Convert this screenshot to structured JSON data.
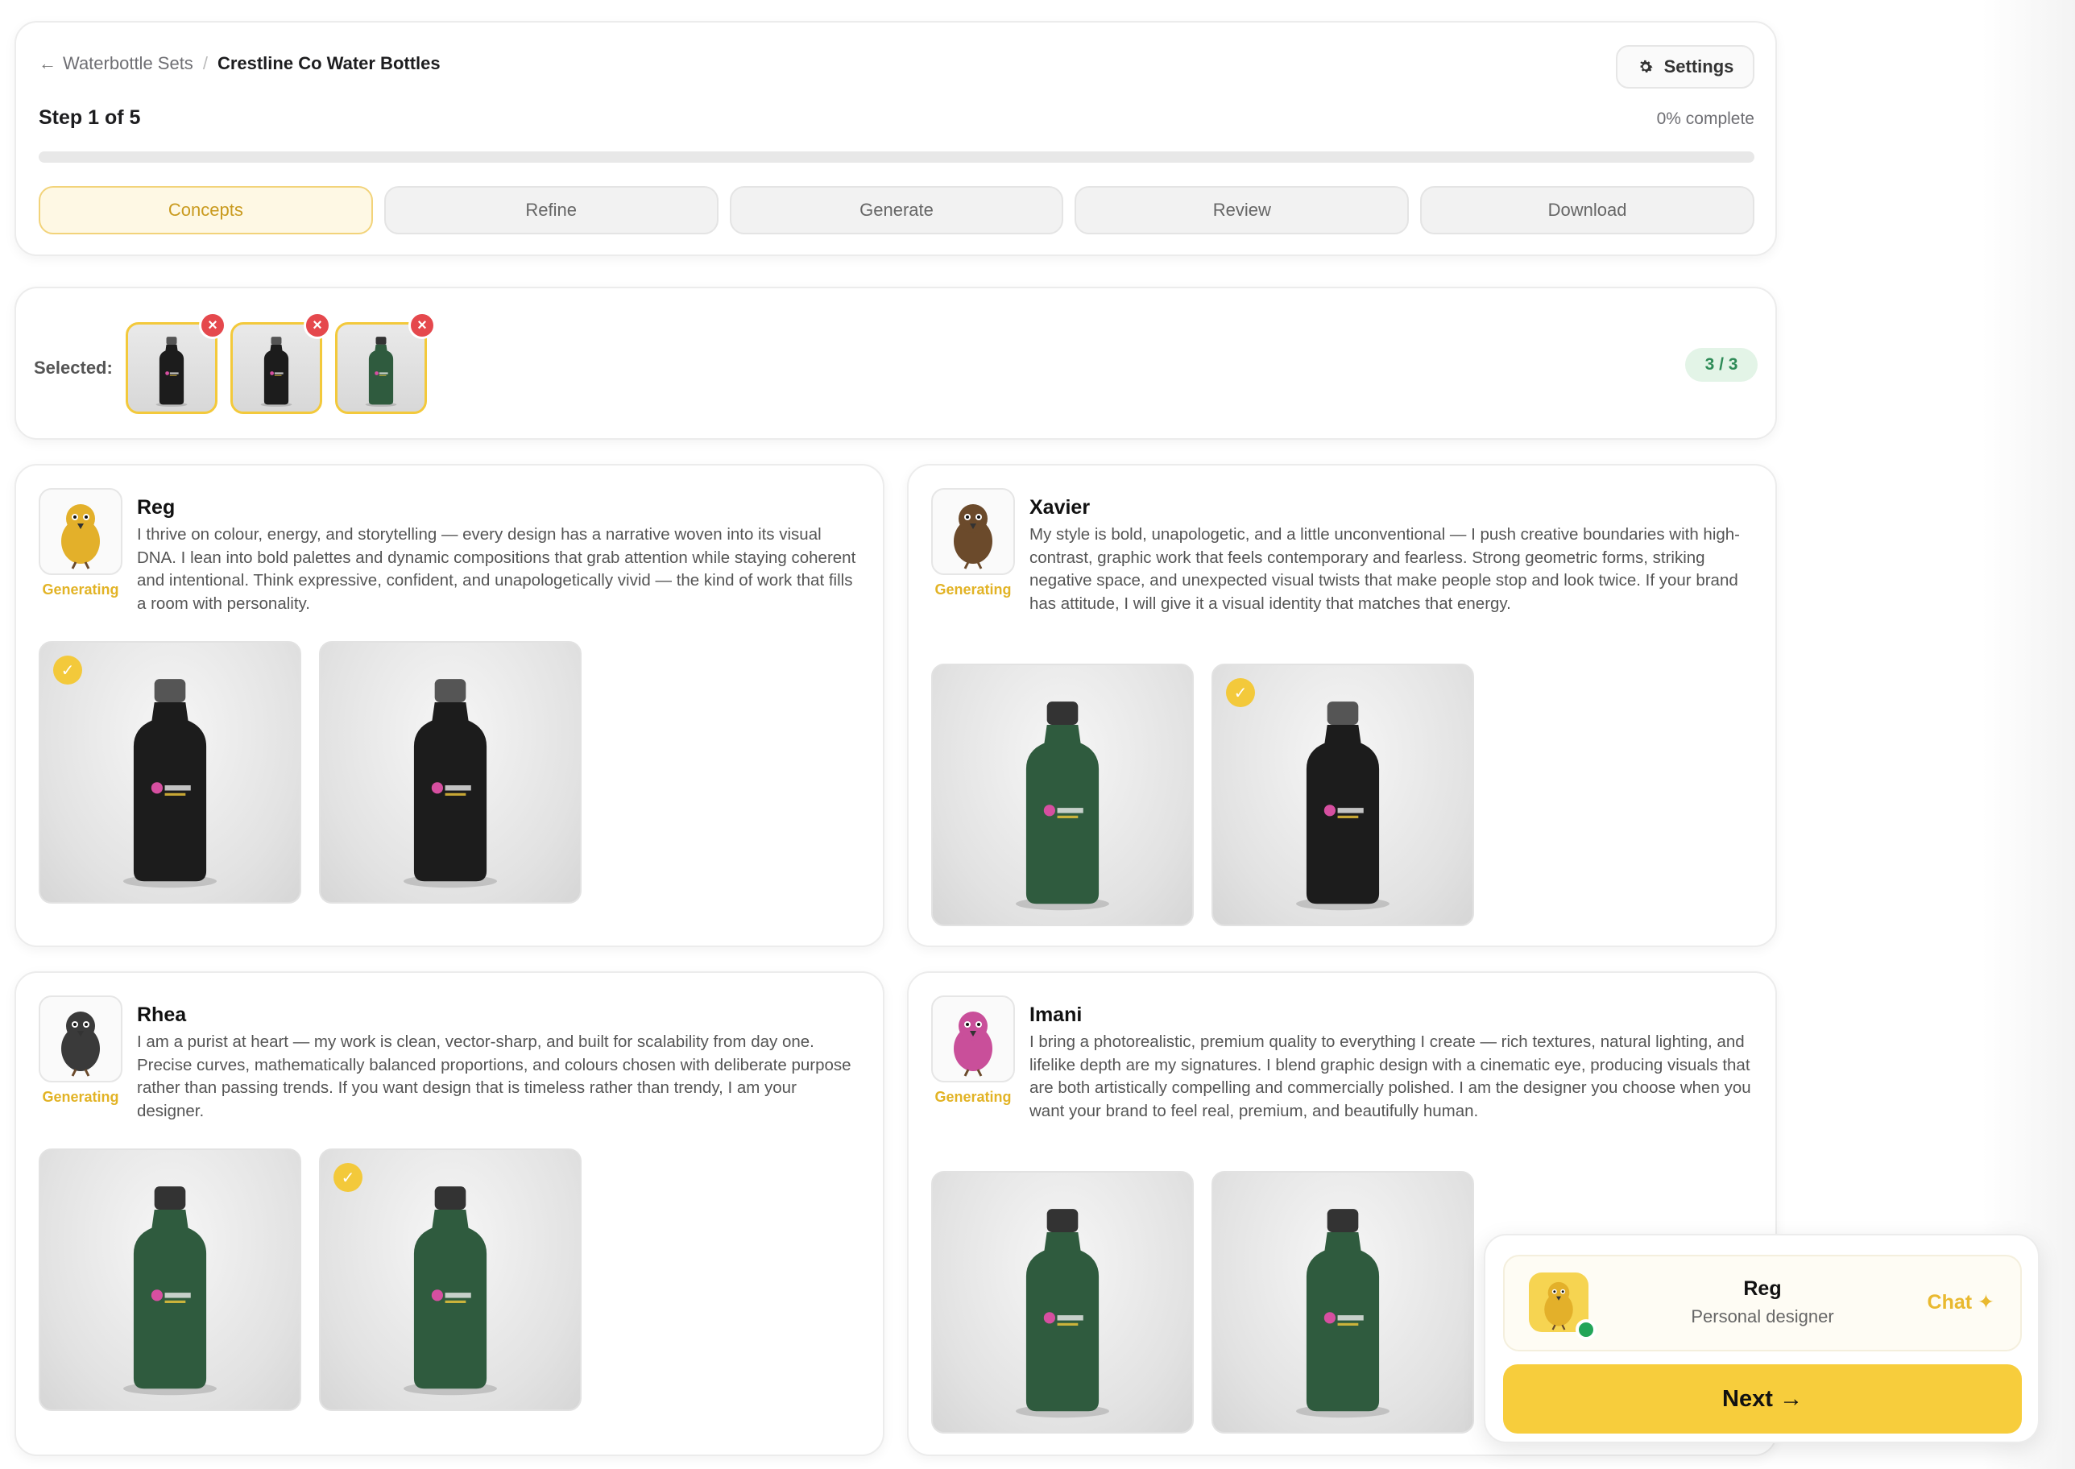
{
  "breadcrumb": {
    "parent": "Waterbottle Sets",
    "current": "Crestline Co Water Bottles"
  },
  "header": {
    "settings_label": "Settings",
    "step_label": "Step 1 of 5",
    "progress_text": "0% complete",
    "progress_fraction": 0.0
  },
  "tabs": [
    {
      "label": "Concepts",
      "active": true
    },
    {
      "label": "Refine",
      "active": false
    },
    {
      "label": "Generate",
      "active": false
    },
    {
      "label": "Review",
      "active": false
    },
    {
      "label": "Download",
      "active": false
    }
  ],
  "selected": {
    "label": "Selected:",
    "count": "3 / 3",
    "thumbs": [
      {
        "bottle": "black"
      },
      {
        "bottle": "black"
      },
      {
        "bottle": "green"
      }
    ]
  },
  "designers": [
    {
      "name": "Reg",
      "status": "Generating",
      "bio": "I thrive on colour, energy, and storytelling — every design has a narrative woven into its visual DNA. I lean into bold palettes and dynamic compositions that grab attention while staying coherent and intentional. Think expressive, confident, and unapologetically vivid — the kind of work that fills a room with personality.",
      "bird_color": "#e3b02a",
      "shots": [
        {
          "bottle": "black",
          "selected": true
        },
        {
          "bottle": "black",
          "selected": false
        }
      ]
    },
    {
      "name": "Xavier",
      "status": "Generating",
      "bio": "My style is bold, unapologetic, and a little unconventional — I push creative boundaries with high-contrast, graphic work that feels contemporary and fearless. Strong geometric forms, striking negative space, and unexpected visual twists that make people stop and look twice. If your brand has attitude, I will give it a visual identity that matches that energy.",
      "bird_color": "#6b4a2b",
      "shots": [
        {
          "bottle": "green",
          "selected": false
        },
        {
          "bottle": "black",
          "selected": true
        }
      ]
    },
    {
      "name": "Rhea",
      "status": "Generating",
      "bio": "I am a purist at heart — my work is clean, vector-sharp, and built for scalability from day one. Precise curves, mathematically balanced proportions, and colours chosen with deliberate purpose rather than passing trends. If you want design that is timeless rather than trendy, I am your designer.",
      "bird_color": "#3a3a3a",
      "shots": [
        {
          "bottle": "green",
          "selected": false
        },
        {
          "bottle": "green",
          "selected": true
        }
      ]
    },
    {
      "name": "Imani",
      "status": "Generating",
      "bio": "I bring a photorealistic, premium quality to everything I create — rich textures, natural lighting, and lifelike depth are my signatures. I blend graphic design with a cinematic eye, producing visuals that are both artistically compelling and commercially polished. I am the designer you choose when you want your brand to feel real, premium, and beautifully human.",
      "bird_color": "#c94f9a",
      "shots": [
        {
          "bottle": "green",
          "selected": false
        },
        {
          "bottle": "green",
          "selected": false
        }
      ]
    }
  ],
  "chat": {
    "name": "Reg",
    "role": "Personal designer",
    "link_label": "Chat ✦",
    "next_label": "Next →"
  },
  "colors": {
    "accent": "#f7cd3c",
    "black_bottle": "#1c1c1c",
    "green_bottle": "#2f5b3e",
    "remove": "#e5484d",
    "online": "#23a559"
  }
}
